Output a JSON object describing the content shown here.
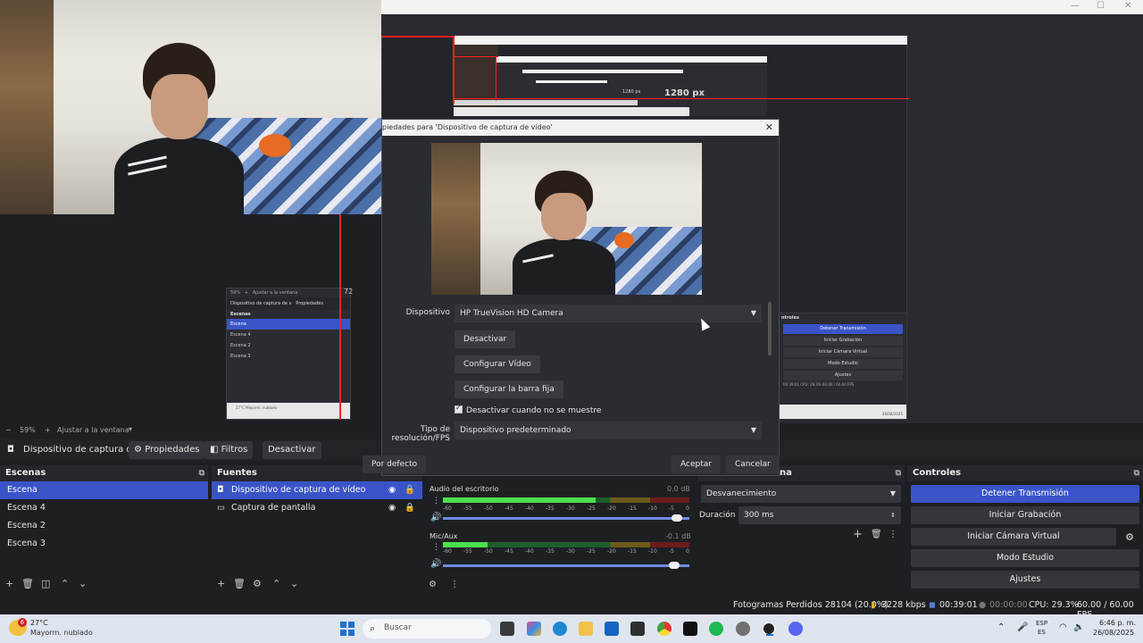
{
  "preview": {
    "nested_px_label": "1280 px",
    "mini_left_items": [
      "Escena",
      "Escena 4",
      "Escena 2",
      "Escena 3"
    ],
    "mini_left_header_source": "Dispositivo de captura de v",
    "mini_left_header_props": "Propiedades",
    "mini_left_header_scenes": "Escenas",
    "mini_right_buttons": [
      "Detener Transmisión",
      "Iniciar Grabación",
      "Iniciar Cámara Virtual",
      "Modo Estudio",
      "Ajustes"
    ],
    "mini_right_header": "ntroles",
    "mini_right_stats": "00:39:01   CPU: 29.3%   60.00 / 60.00 FPS",
    "mini_left_weather": "27°C Mayorm. nublado",
    "mini_zoom": "59%",
    "mini_fit": "Ajustar a la ventana",
    "mini_right_date": "26/08/2025",
    "partial_label": "72"
  },
  "preview_status": {
    "zoom": "59%",
    "fit": "Ajustar a la ventana"
  },
  "toolbar": {
    "source_name": "Dispositivo de captura de v",
    "properties": "Propiedades",
    "filters": "Filtros",
    "deactivate": "Desactivar"
  },
  "dialog": {
    "title": "piedades para 'Dispositivo de captura de vídeo'",
    "device_label": "Dispositivo",
    "device_value": "HP TrueVision HD Camera",
    "btn_deactivate": "Desactivar",
    "btn_config_video": "Configurar Vídeo",
    "btn_config_bar": "Configurar la barra fija",
    "checkbox_label": "Desactivar cuando no se muestre",
    "res_label": "Tipo de resolución/FPS",
    "res_value": "Dispositivo predeterminado",
    "btn_default": "Por defecto",
    "btn_accept": "Aceptar",
    "btn_cancel": "Cancelar"
  },
  "scenes": {
    "title": "Escenas",
    "items": [
      "Escena",
      "Escena 4",
      "Escena 2",
      "Escena 3"
    ]
  },
  "sources": {
    "title": "Fuentes",
    "items": [
      "Dispositivo de captura de vídeo",
      "Captura de pantalla"
    ]
  },
  "mixer": {
    "ch1_name": "Audio del escritorio",
    "ch1_db": "0.0 dB",
    "ch2_name": "Mic/Aux",
    "ch2_db": "-0.1 dB",
    "ch1_level": 0.62,
    "ch2_level": 0.18,
    "ch1_volume": 0.97,
    "ch2_volume": 0.96,
    "scale": [
      "-60",
      "-55",
      "-50",
      "-45",
      "-40",
      "-35",
      "-30",
      "-25",
      "-20",
      "-15",
      "-10",
      "-5",
      "0"
    ]
  },
  "transitions": {
    "title": "na",
    "type": "Desvanecimiento",
    "duration_label": "Duración",
    "duration_value": "300 ms"
  },
  "controls": {
    "title": "Controles",
    "buttons": [
      "Detener Transmisión",
      "Iniciar Grabación",
      "Iniciar Cámara Virtual",
      "Modo Estudio",
      "Ajustes"
    ]
  },
  "status": {
    "dropped": "Fotogramas Perdidos 28104 (20.0%)",
    "bitrate": "3228 kbps",
    "stream_time": "00:39:01",
    "rec_time": "00:00:00",
    "cpu": "CPU: 29.3%",
    "fps": "60.00 / 60.00 FPS"
  },
  "taskbar": {
    "weather_temp": "27°C",
    "weather_desc": "Mayorm. nublado",
    "notif_count": "6",
    "search_placeholder": "Buscar",
    "lang1": "ESP",
    "lang2": "ES",
    "time": "6:46 p. m.",
    "date": "26/08/2025"
  },
  "colors": {
    "accent": "#3a54c8",
    "background": "#1e1f23",
    "red_guide": "#ff2020"
  }
}
